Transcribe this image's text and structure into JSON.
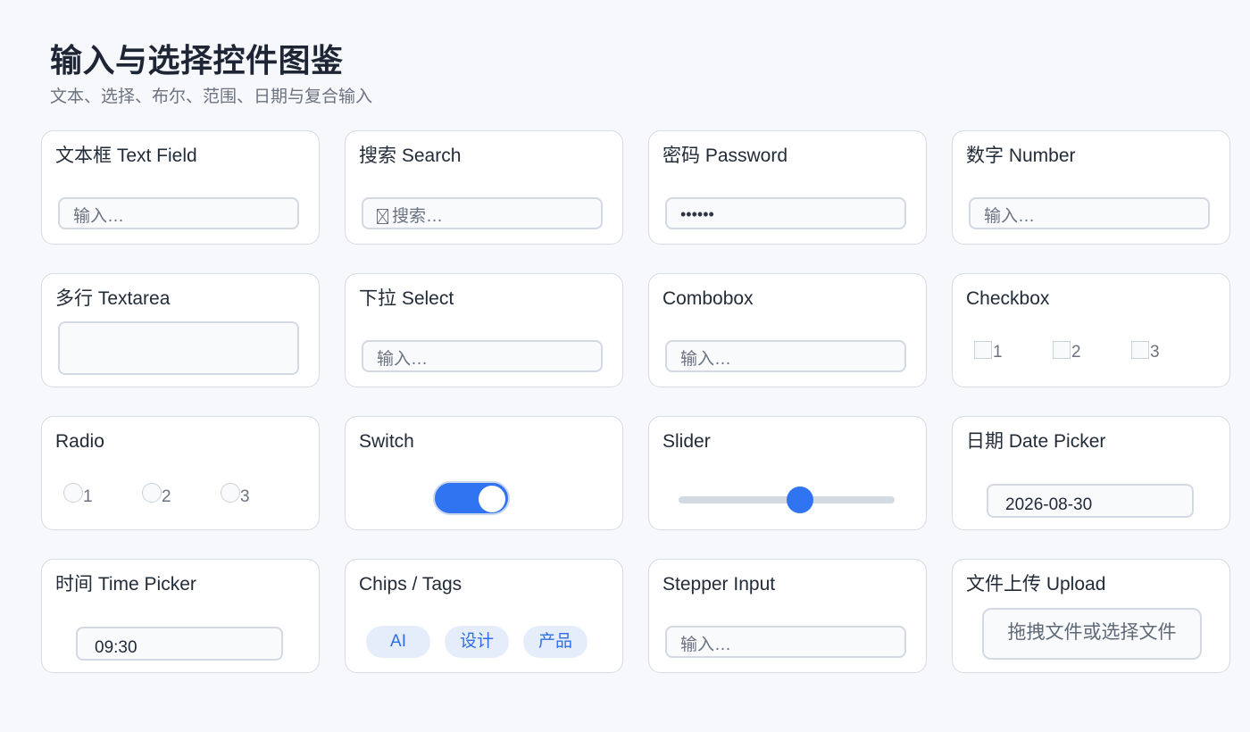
{
  "page": {
    "title": "输入与选择控件图鉴",
    "subtitle": "文本、选择、布尔、范围、日期与复合输入"
  },
  "colors": {
    "accent": "#3174f2",
    "chip_bg": "#e5edfb",
    "chip_text": "#2f6fe0",
    "border": "#d5dbe5",
    "background": "#f6f8fb"
  },
  "cards": {
    "text_field": {
      "label": "文本框 Text Field",
      "placeholder": "输入…"
    },
    "search": {
      "label": "搜索 Search",
      "icon": "search-box-icon",
      "placeholder": "搜索…"
    },
    "password": {
      "label": "密码 Password",
      "value": "••••••"
    },
    "number": {
      "label": "数字 Number",
      "placeholder": "输入…"
    },
    "textarea": {
      "label": "多行 Textarea",
      "value": ""
    },
    "select": {
      "label": "下拉 Select",
      "placeholder": "输入…"
    },
    "combobox": {
      "label": "Combobox",
      "placeholder": "输入…"
    },
    "checkbox": {
      "label": "Checkbox",
      "options": [
        "1",
        "2",
        "3"
      ],
      "checked": [
        false,
        false,
        false
      ]
    },
    "radio": {
      "label": "Radio",
      "options": [
        "1",
        "2",
        "3"
      ],
      "selected": null
    },
    "switch": {
      "label": "Switch",
      "on": true
    },
    "slider": {
      "label": "Slider",
      "value_fraction": 0.56
    },
    "date_picker": {
      "label": "日期 Date Picker",
      "value": "2026-08-30"
    },
    "time_picker": {
      "label": "时间 Time Picker",
      "value": "09:30"
    },
    "chips": {
      "label": "Chips / Tags",
      "items": [
        "AI",
        "设计",
        "产品"
      ]
    },
    "stepper": {
      "label": "Stepper Input",
      "placeholder": "输入…"
    },
    "upload": {
      "label": "文件上传 Upload",
      "prompt": "拖拽文件或选择文件"
    }
  }
}
